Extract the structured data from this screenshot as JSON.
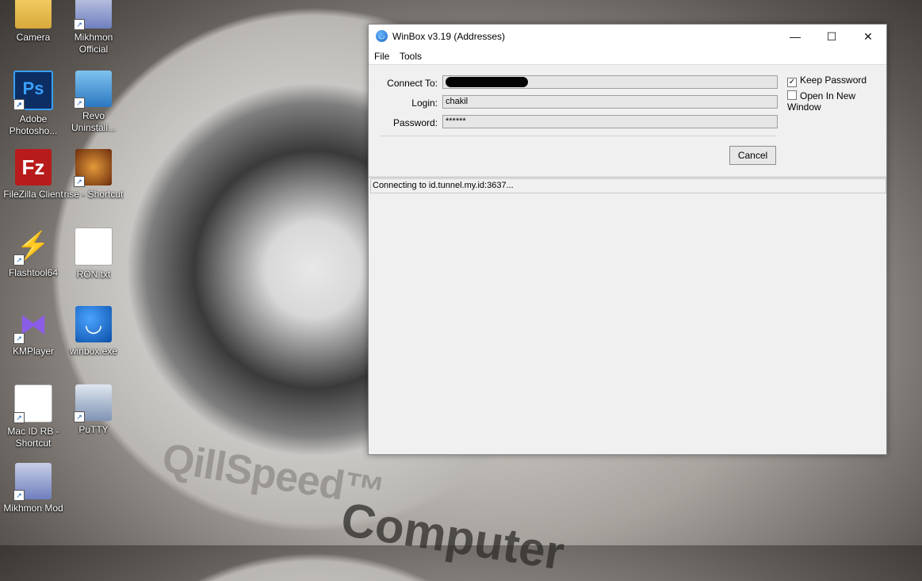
{
  "desktop": {
    "icons": [
      {
        "label": "Camera",
        "icon": "folder-icon"
      },
      {
        "label": "Mikhmon Official",
        "icon": "mikhmon-icon"
      },
      {
        "label": "Adobe Photosho...",
        "icon": "photoshop-icon",
        "glyph": "Ps"
      },
      {
        "label": "Revo Uninstall...",
        "icon": "revo-icon"
      },
      {
        "label": "FileZilla Client",
        "icon": "filezilla-icon",
        "glyph": "Fz"
      },
      {
        "label": "rise - Shortcut",
        "icon": "rise-icon"
      },
      {
        "label": "Flashtool64",
        "icon": "flashtool-icon"
      },
      {
        "label": "RON.txt",
        "icon": "text-file-icon"
      },
      {
        "label": "KMPlayer",
        "icon": "kmplayer-icon"
      },
      {
        "label": "winbox.exe",
        "icon": "winbox-icon"
      },
      {
        "label": "Mac ID RB - Shortcut",
        "icon": "text-file-icon"
      },
      {
        "label": "PuTTY",
        "icon": "putty-icon"
      },
      {
        "label": "Mikhmon Mod",
        "icon": "mikhmon-icon"
      }
    ],
    "wallpaper_text": {
      "line1": "QillSpeed™",
      "line2": "Computer"
    }
  },
  "window": {
    "title": "WinBox v3.19 (Addresses)",
    "menu": [
      "File",
      "Tools"
    ],
    "form": {
      "connect_to_label": "Connect To:",
      "connect_to_value": "",
      "login_label": "Login:",
      "login_value": "chakil",
      "password_label": "Password:",
      "password_value": "******"
    },
    "options": {
      "keep_password": {
        "label": "Keep Password",
        "checked": true
      },
      "open_in_new_window": {
        "label": "Open In New Window",
        "checked": false
      }
    },
    "cancel_label": "Cancel",
    "status": "Connecting to id.tunnel.my.id:3637..."
  }
}
